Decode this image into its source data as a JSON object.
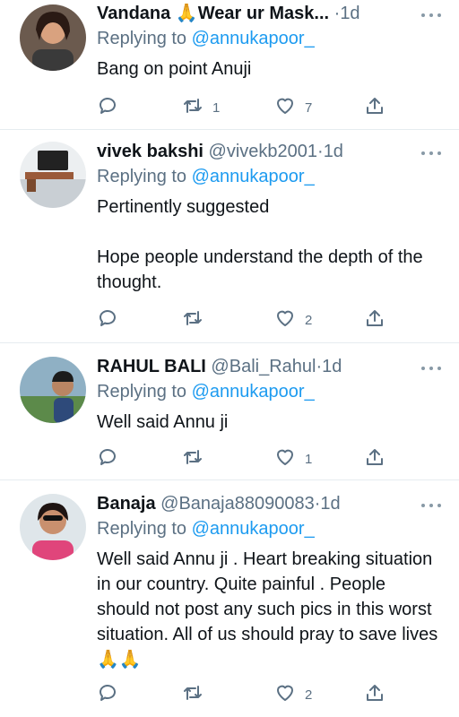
{
  "tweets": [
    {
      "name": "Vandana 🙏Wear ur Mask...",
      "handle": "",
      "time": "1d",
      "replying_prefix": "Replying to",
      "replying_to": "@annukapoor_",
      "text": [
        "Bang on point Anuji"
      ],
      "retweets": "1",
      "likes": "7"
    },
    {
      "name": "vivek bakshi",
      "handle": "@vivekb2001",
      "time": "1d",
      "replying_prefix": "Replying to",
      "replying_to": "@annukapoor_",
      "text": [
        "Pertinently suggested",
        "Hope people understand the depth of the thought."
      ],
      "retweets": "",
      "likes": "2"
    },
    {
      "name": "RAHUL BALI",
      "handle": "@Bali_Rahul",
      "time": "1d",
      "replying_prefix": "Replying to",
      "replying_to": "@annukapoor_",
      "text": [
        "Well said Annu ji"
      ],
      "retweets": "",
      "likes": "1"
    },
    {
      "name": "Banaja",
      "handle": "@Banaja88090083",
      "time": "1d",
      "replying_prefix": "Replying to",
      "replying_to": "@annukapoor_",
      "text": [
        "Well said Annu ji . Heart breaking situation in our country. Quite painful . People should not post any such pics in this worst situation. All of us should pray to save lives 🙏🙏"
      ],
      "retweets": "",
      "likes": "2"
    }
  ],
  "colors": {
    "secondary": "#5b7083",
    "link": "#1d9bf0",
    "divider": "#e6ecf0"
  },
  "icons": [
    "reply-icon",
    "retweet-icon",
    "like-icon",
    "share-icon",
    "more-icon"
  ]
}
